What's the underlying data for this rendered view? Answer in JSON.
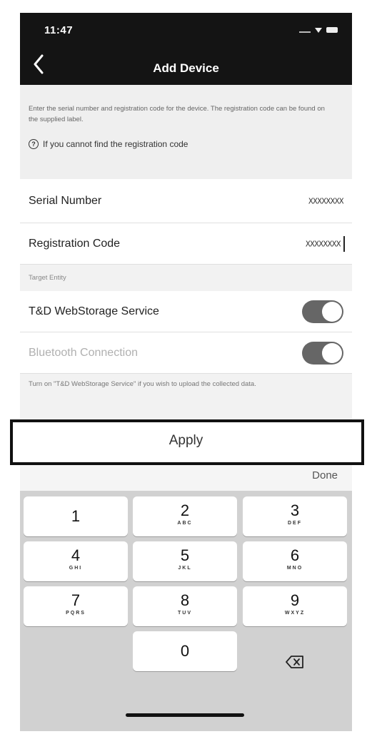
{
  "status": {
    "time": "11:47"
  },
  "nav": {
    "title": "Add Device"
  },
  "info": {
    "instructions": "Enter the serial number and registration code for the device. The registration code can be found on the supplied label.",
    "help_link": "If you cannot find the registration code"
  },
  "fields": {
    "serial_label": "Serial Number",
    "serial_value": "XXXXXXXX",
    "registration_label": "Registration Code",
    "registration_value": "XXXXXXXX"
  },
  "target": {
    "section_label": "Target Entity",
    "webstorage_label": "T&D WebStorage Service",
    "webstorage_on": true,
    "bluetooth_label": "Bluetooth Connection",
    "bluetooth_on": true,
    "note": "Turn on \"T&D WebStorage Service\" if you wish to upload the collected data."
  },
  "apply_label": "Apply",
  "keyboard": {
    "done_label": "Done",
    "keys": [
      {
        "num": "1",
        "letters": ""
      },
      {
        "num": "2",
        "letters": "ABC"
      },
      {
        "num": "3",
        "letters": "DEF"
      },
      {
        "num": "4",
        "letters": "GHI"
      },
      {
        "num": "5",
        "letters": "JKL"
      },
      {
        "num": "6",
        "letters": "MNO"
      },
      {
        "num": "7",
        "letters": "PQRS"
      },
      {
        "num": "8",
        "letters": "TUV"
      },
      {
        "num": "9",
        "letters": "WXYZ"
      },
      {
        "num": "0",
        "letters": ""
      }
    ]
  },
  "icons": {
    "back": "chevron-left-icon",
    "help": "question-circle-icon",
    "backspace": "backspace-icon"
  },
  "colors": {
    "nav_bar": "#141414",
    "toggle_on": "#666666",
    "highlight_border": "#111111"
  }
}
